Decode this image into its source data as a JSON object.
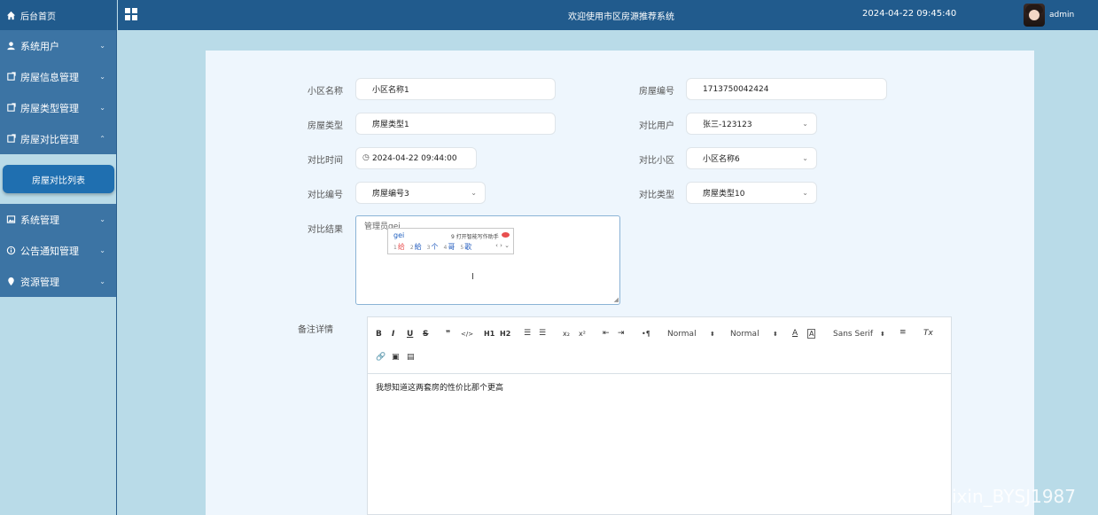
{
  "sidebar": {
    "home": "后台首页",
    "items": [
      {
        "label": "系统用户",
        "icon": "user-icon",
        "chevron": "⌄"
      },
      {
        "label": "房屋信息管理",
        "icon": "doc-icon",
        "chevron": "⌄"
      },
      {
        "label": "房屋类型管理",
        "icon": "doc-icon",
        "chevron": "⌄"
      },
      {
        "label": "房屋对比管理",
        "icon": "doc-icon",
        "chevron": "⌃"
      }
    ],
    "sub_item": "房屋对比列表",
    "items2": [
      {
        "label": "系统管理",
        "icon": "image-icon",
        "chevron": "⌄"
      },
      {
        "label": "公告通知管理",
        "icon": "info-icon",
        "chevron": "⌄"
      },
      {
        "label": "资源管理",
        "icon": "pin-icon",
        "chevron": "⌄"
      }
    ]
  },
  "header": {
    "title": "欢迎使用市区房源推荐系统",
    "datetime": "2024-04-22 09:45:40",
    "user": "admin"
  },
  "form": {
    "community_name_label": "小区名称",
    "community_name_value": "小区名称1",
    "house_no_label": "房屋编号",
    "house_no_value": "1713750042424",
    "house_type_label": "房屋类型",
    "house_type_value": "房屋类型1",
    "compare_user_label": "对比用户",
    "compare_user_value": "张三-123123",
    "compare_time_label": "对比时间",
    "compare_time_value": "2024-04-22 09:44:00",
    "compare_community_label": "对比小区",
    "compare_community_value": "小区名称6",
    "compare_no_label": "对比编号",
    "compare_no_value": "房屋编号3",
    "compare_type_label": "对比类型",
    "compare_type_value": "房屋类型10",
    "result_label": "对比结果",
    "result_value": "管理员gei",
    "remark_label": "备注详情",
    "remark_content": "我想知道这两套房的性价比那个更高"
  },
  "ime": {
    "input": "gei",
    "assist": "9 打开智能写作助手",
    "candidates": [
      {
        "n": "1",
        "text": "给"
      },
      {
        "n": "2",
        "text": "給"
      },
      {
        "n": "3",
        "text": "个"
      },
      {
        "n": "4",
        "text": "哥"
      },
      {
        "n": "5",
        "text": "歌"
      }
    ],
    "nav": "‹ › ⌄"
  },
  "editor": {
    "bold": "B",
    "italic": "I",
    "underline": "U",
    "strike": "S",
    "quote": "❞",
    "code": "</>",
    "h1": "H1",
    "h2": "H2",
    "sub": "x₂",
    "sup": "x²",
    "dir": "•¶",
    "size_value": "Normal",
    "header_value": "Normal",
    "font_value": "Sans Serif",
    "color": "A",
    "clear": "Tx"
  },
  "watermark": "CSDN @weixin_BYSJ1987"
}
